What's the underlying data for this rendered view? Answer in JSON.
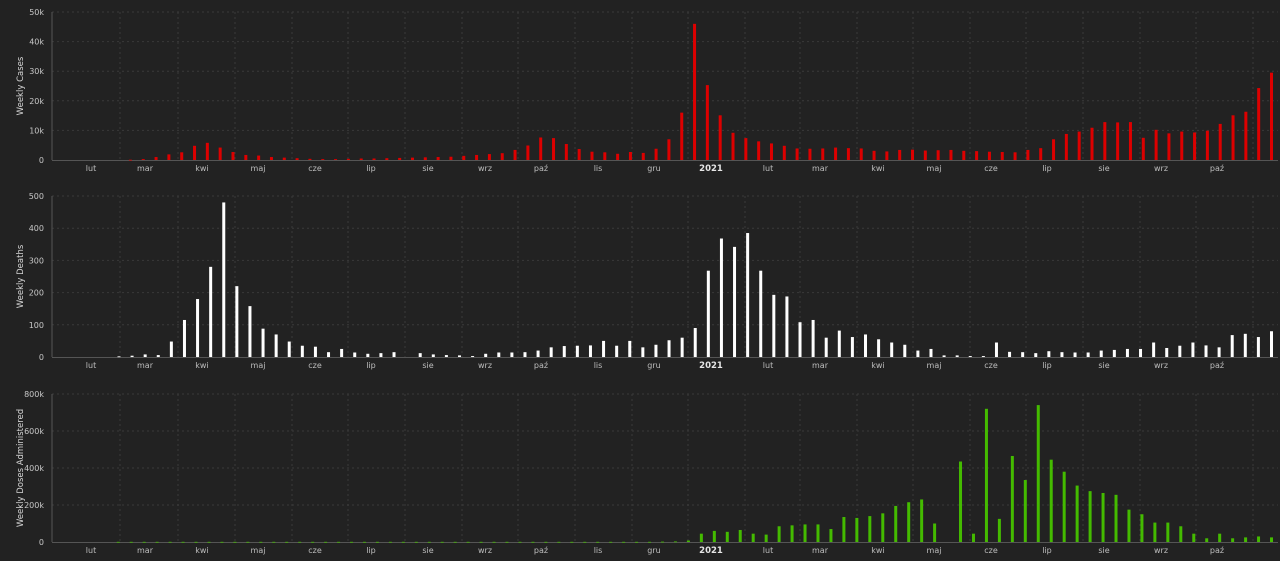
{
  "chart_data": [
    {
      "type": "bar",
      "ylabel": "Weekly Cases",
      "ylim": [
        0,
        50000
      ],
      "y_ticks": [
        0,
        10000,
        20000,
        30000,
        40000,
        50000
      ],
      "y_tick_labels": [
        "0",
        "10k",
        "20k",
        "30k",
        "40k",
        "50k"
      ],
      "x_tick_labels": [
        "lut",
        "mar",
        "kwi",
        "maj",
        "cze",
        "lip",
        "sie",
        "wrz",
        "paź",
        "lis",
        "gru",
        "2021",
        "lut",
        "mar",
        "kwi",
        "maj",
        "cze",
        "lip",
        "sie",
        "wrz",
        "paź"
      ],
      "grid": true,
      "bar_color": "#dd0000",
      "values": [
        0,
        0,
        0,
        0,
        0,
        0,
        100,
        300,
        1000,
        1900,
        2600,
        4800,
        5800,
        4200,
        2700,
        1700,
        1500,
        1000,
        800,
        600,
        400,
        300,
        300,
        400,
        500,
        500,
        600,
        700,
        800,
        900,
        1000,
        1100,
        1400,
        1700,
        2000,
        2300,
        3400,
        4900,
        7600,
        7400,
        5400,
        3700,
        2800,
        2600,
        2100,
        2700,
        2400,
        3800,
        7000,
        16000,
        46000,
        25300,
        15100,
        9200,
        7400,
        6300,
        5600,
        4800,
        3900,
        3800,
        3900,
        4200,
        4000,
        3900,
        3100,
        2900,
        3400,
        3500,
        3200,
        3300,
        3400,
        3100,
        3000,
        2800,
        2700,
        2600,
        3400,
        4000,
        7000,
        8800,
        9600,
        10900,
        12800,
        12700,
        12800,
        7500,
        10200,
        9000,
        9600,
        9300,
        9900,
        12200,
        15100,
        16300,
        24300,
        29500
      ]
    },
    {
      "type": "bar",
      "ylabel": "Weekly Deaths",
      "ylim": [
        0,
        500
      ],
      "y_ticks": [
        0,
        100,
        200,
        300,
        400,
        500
      ],
      "y_tick_labels": [
        "0",
        "100",
        "200",
        "300",
        "400",
        "500"
      ],
      "x_tick_labels": [
        "lut",
        "mar",
        "kwi",
        "maj",
        "cze",
        "lip",
        "sie",
        "wrz",
        "paź",
        "lis",
        "gru",
        "2021",
        "lut",
        "mar",
        "kwi",
        "maj",
        "cze",
        "lip",
        "sie",
        "wrz",
        "paź"
      ],
      "grid": true,
      "bar_color": "#ffffff",
      "values": [
        0,
        0,
        0,
        0,
        0,
        2,
        4,
        8,
        6,
        48,
        115,
        180,
        280,
        480,
        220,
        158,
        88,
        70,
        48,
        35,
        32,
        15,
        25,
        14,
        10,
        12,
        15,
        0,
        12,
        8,
        6,
        5,
        3,
        10,
        14,
        14,
        15,
        20,
        30,
        34,
        35,
        36,
        50,
        35,
        50,
        30,
        38,
        52,
        60,
        90,
        268,
        368,
        342,
        385,
        268,
        193,
        188,
        108,
        115,
        60,
        82,
        62,
        70,
        55,
        45,
        38,
        20,
        25,
        5,
        5,
        3,
        3,
        45,
        16,
        15,
        12,
        18,
        15,
        14,
        14,
        20,
        22,
        25,
        25,
        45,
        28,
        35,
        45,
        36,
        30,
        68,
        72,
        62,
        80
      ]
    },
    {
      "type": "bar",
      "ylabel": "Weekly Doses Administered",
      "ylim": [
        0,
        800000
      ],
      "y_ticks": [
        0,
        200000,
        400000,
        600000,
        800000
      ],
      "y_tick_labels": [
        "0",
        "200k",
        "400k",
        "600k",
        "800k"
      ],
      "x_tick_labels": [
        "lut",
        "mar",
        "kwi",
        "maj",
        "cze",
        "lip",
        "sie",
        "wrz",
        "paź",
        "lis",
        "gru",
        "2021",
        "lut",
        "mar",
        "kwi",
        "maj",
        "cze",
        "lip",
        "sie",
        "wrz",
        "paź"
      ],
      "grid": true,
      "bar_color": "#44bb00",
      "values": [
        0,
        0,
        0,
        0,
        0,
        1000,
        1000,
        1000,
        1000,
        1000,
        1000,
        1000,
        1000,
        1000,
        1000,
        1000,
        1000,
        1000,
        1000,
        1000,
        1000,
        1000,
        1000,
        1000,
        1000,
        1000,
        1000,
        1000,
        1000,
        1000,
        1000,
        1000,
        1000,
        1000,
        1000,
        1000,
        1000,
        1000,
        1000,
        1000,
        1000,
        1000,
        1000,
        1000,
        1000,
        1000,
        1000,
        2000,
        3000,
        8000,
        45000,
        60000,
        55000,
        65000,
        45000,
        40000,
        85000,
        90000,
        95000,
        95000,
        70000,
        135000,
        130000,
        140000,
        155000,
        195000,
        215000,
        230000,
        100000,
        0,
        435000,
        45000,
        720000,
        125000,
        465000,
        335000,
        740000,
        445000,
        380000,
        305000,
        275000,
        265000,
        255000,
        175000,
        150000,
        105000,
        105000,
        85000,
        45000,
        20000,
        45000,
        20000,
        25000,
        30000,
        25000
      ]
    }
  ]
}
